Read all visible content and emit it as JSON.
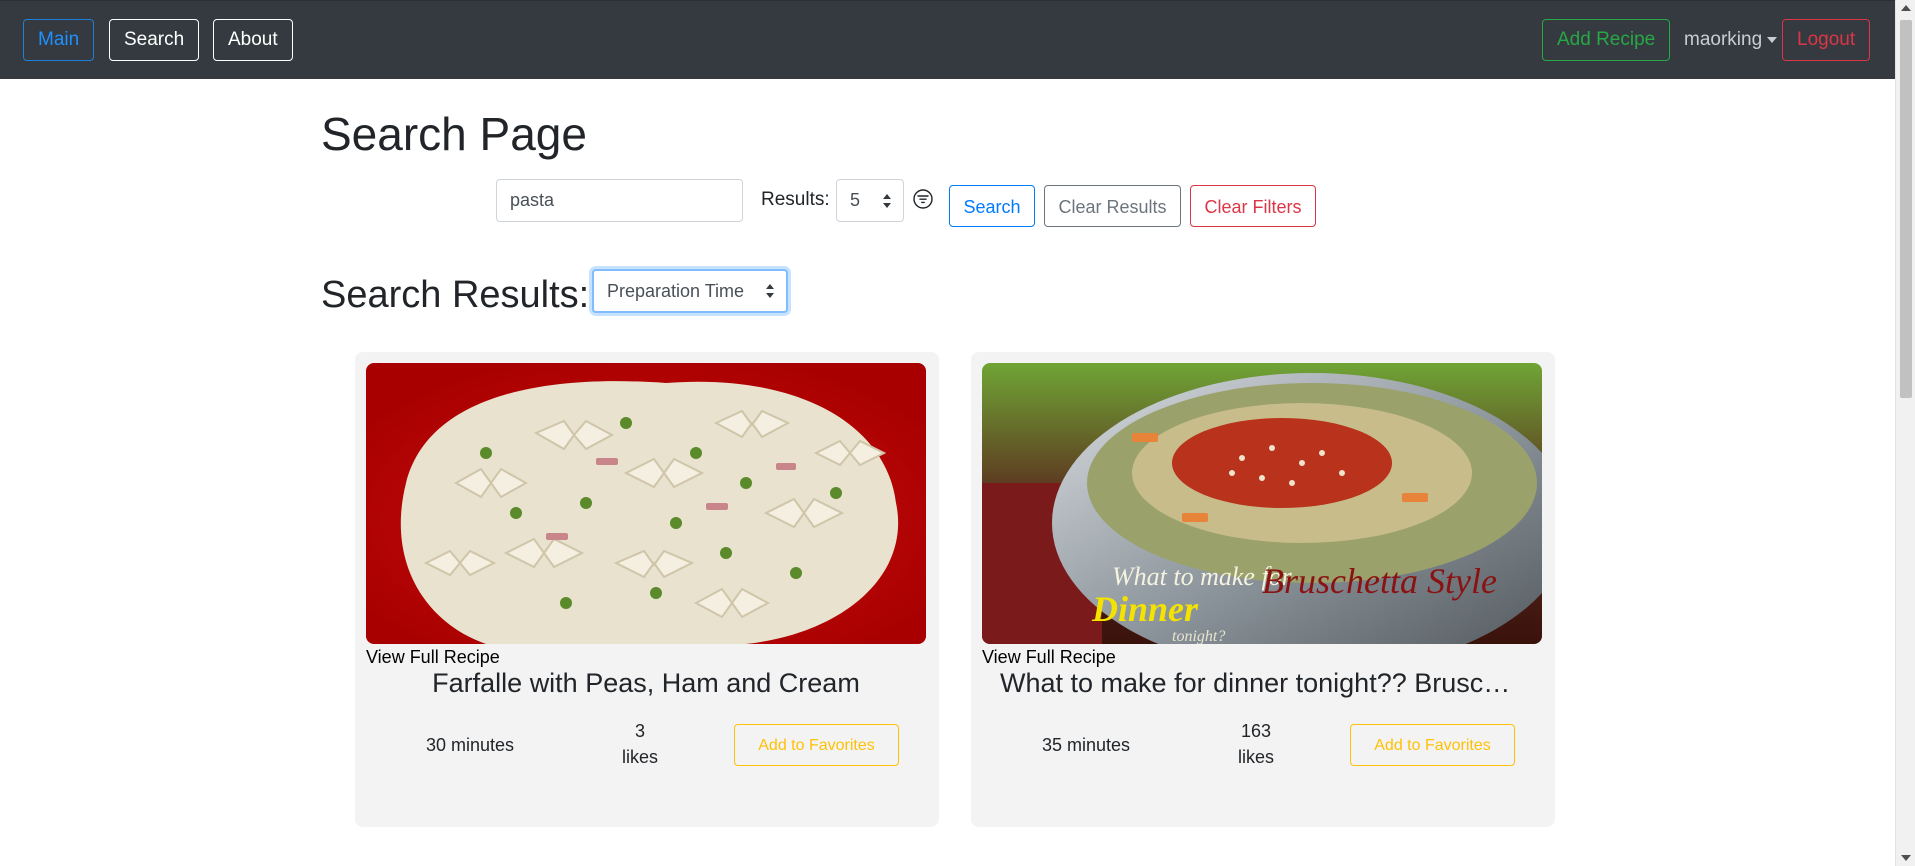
{
  "navbar": {
    "main_label": "Main",
    "search_label": "Search",
    "about_label": "About",
    "add_recipe_label": "Add Recipe",
    "username": "maorking",
    "logout_label": "Logout"
  },
  "search_page": {
    "title": "Search Page",
    "query_value": "pasta",
    "results_label": "Results:",
    "results_count": "5",
    "search_button": "Search",
    "clear_results_button": "Clear Results",
    "clear_filters_button": "Clear Filters",
    "results_heading": "Search Results:",
    "sort_by": "Preparation Time"
  },
  "recipes": [
    {
      "view_link": "View Full Recipe",
      "title": "Farfalle with Peas, Ham and Cream",
      "time": "30 minutes",
      "likes_count": "3",
      "likes_label": "likes",
      "favorite_button": "Add to Favorites"
    },
    {
      "view_link": "View Full Recipe",
      "title": "What to make for dinner tonight?? Bruschetta Style Pork & Pasta",
      "time": "35 minutes",
      "likes_count": "163",
      "likes_label": "likes",
      "favorite_button": "Add to Favorites",
      "image_overlay_text": {
        "line1": "What to make for",
        "line2": "Dinner",
        "line3": "tonight?",
        "line4": "Bruschetta Style"
      }
    }
  ],
  "colors": {
    "navbar_bg": "#343a40",
    "primary": "#007bff",
    "success": "#28a745",
    "danger": "#dc3545",
    "warning": "#ffc107",
    "secondary": "#6c757d",
    "card_bg": "#f3f3f3"
  },
  "icons": {
    "filter": "filter-circle-icon",
    "user_dropdown": "caret-down-icon",
    "select_arrows": "updown-arrows-icon"
  }
}
